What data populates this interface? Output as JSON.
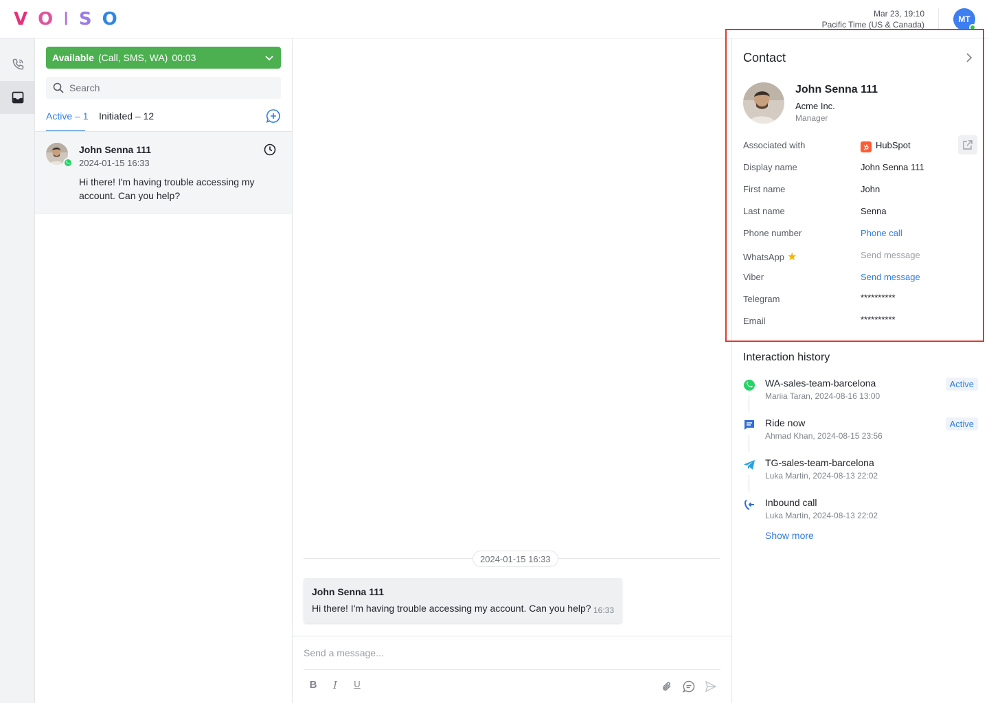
{
  "header": {
    "logo_letters": [
      "V",
      "O",
      "I",
      "S",
      "O"
    ],
    "time": "Mar 23, 19:10",
    "timezone": "Pacific Time (US & Canada)",
    "user_initials": "MT"
  },
  "rail": {
    "items": [
      "phone-calls-icon",
      "inbox-icon"
    ]
  },
  "list": {
    "status_label": "Available",
    "status_channels": "(Call, SMS, WA)",
    "status_timer": "00:03",
    "status_color": "#4caf50",
    "search_placeholder": "Search",
    "tab_active": "Active – 1",
    "tab_initiated": "Initiated – 12",
    "conversation": {
      "name": "John Senna 111",
      "date": "2024-01-15 16:33",
      "text": "Hi there! I'm having trouble accessing my account. Can you help?"
    }
  },
  "chat": {
    "date_divider": "2024-01-15 16:33",
    "message": {
      "author": "John Senna 111",
      "text": "Hi there! I'm having trouble accessing my account. Can you help?",
      "time": "16:33"
    },
    "composer_placeholder": "Send a message...",
    "format_bold": "B",
    "format_italic": "I",
    "format_underline": "U"
  },
  "contact": {
    "title": "Contact",
    "name": "John Senna 111",
    "company": "Acme Inc.",
    "role": "Manager",
    "fields": {
      "associated_label": "Associated with",
      "associated_value": "HubSpot",
      "display_name_label": "Display name",
      "display_name_value": "John Senna 111",
      "first_name_label": "First name",
      "first_name_value": "John",
      "last_name_label": "Last name",
      "last_name_value": "Senna",
      "phone_label": "Phone number",
      "phone_value": "Phone call",
      "whatsapp_label": "WhatsApp",
      "whatsapp_value": "Send message",
      "viber_label": "Viber",
      "viber_value": "Send message",
      "telegram_label": "Telegram",
      "telegram_value": "**********",
      "email_label": "Email",
      "email_value": "**********"
    }
  },
  "history": {
    "title": "Interaction history",
    "items": [
      {
        "name": "WA-sales-team-barcelona",
        "meta": "Mariia Taran, 2024-08-16 13:00",
        "badge": "Active",
        "icon": "whatsapp-icon"
      },
      {
        "name": "Ride now",
        "meta": "Ahmad Khan, 2024-08-15 23:56",
        "badge": "Active",
        "icon": "chat-icon"
      },
      {
        "name": "TG-sales-team-barcelona",
        "meta": "Luka Martin, 2024-08-13 22:02",
        "badge": "",
        "icon": "telegram-icon"
      },
      {
        "name": "Inbound call",
        "meta": "Luka Martin, 2024-08-13 22:02",
        "badge": "",
        "icon": "inbound-call-icon"
      }
    ],
    "show_more": "Show more"
  },
  "colors": {
    "accent": "#2f7de1",
    "available": "#4caf50",
    "highlight": "#e0382f",
    "whatsapp": "#25d366",
    "hubspot": "#ff5c35"
  }
}
